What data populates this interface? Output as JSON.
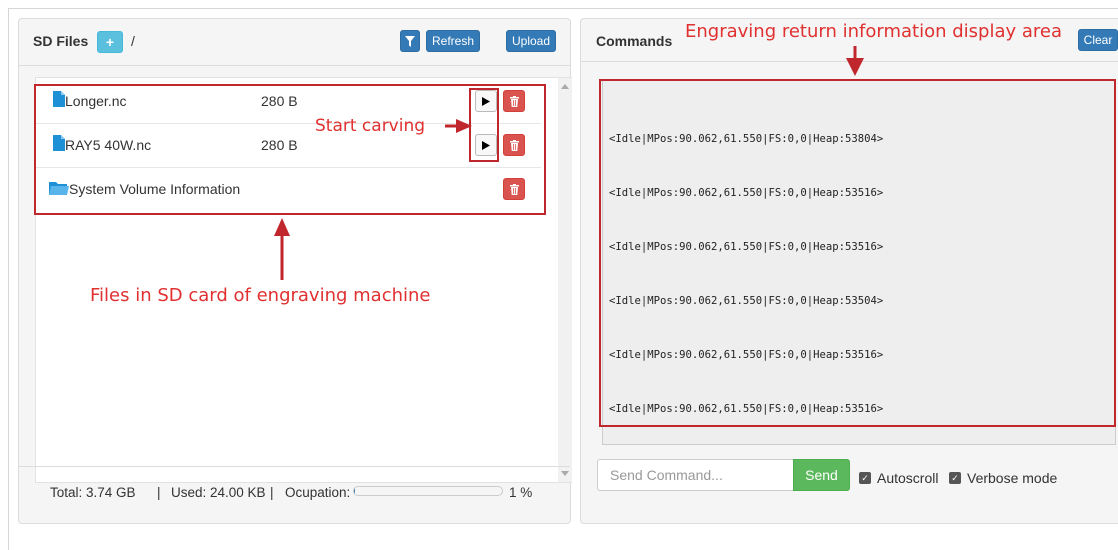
{
  "sd_panel": {
    "title": "SD Files",
    "path": "/",
    "add_folder_label": "+",
    "filter_icon": "filter-icon",
    "refresh_label": "Refresh",
    "upload_label": "Upload",
    "files": [
      {
        "name": "Longer.nc",
        "size": "280 B",
        "type": "file"
      },
      {
        "name": "RAY5 40W.nc",
        "size": "280 B",
        "type": "file"
      },
      {
        "name": "System Volume Information",
        "size": "",
        "type": "folder"
      }
    ],
    "footer": {
      "total": "Total: 3.74 GB",
      "sep1": "|",
      "used": "Used: 24.00 KB",
      "sep2": "|",
      "ocupation_label": "Ocupation:",
      "ocupation_percent": "1 %",
      "ocupation_fraction": 0.01
    }
  },
  "commands_panel": {
    "title": "Commands",
    "clear_label": "Clear",
    "lines": [
      "<Idle|MPos:90.062,61.550|FS:0,0|Heap:53804>",
      "<Idle|MPos:90.062,61.550|FS:0,0|Heap:53516>",
      "<Idle|MPos:90.062,61.550|FS:0,0|Heap:53516>",
      "<Idle|MPos:90.062,61.550|FS:0,0|Heap:53504>",
      "<Idle|MPos:90.062,61.550|FS:0,0|Heap:53516>",
      "<Idle|MPos:90.062,61.550|FS:0,0|Heap:53516>"
    ],
    "input_placeholder": "Send Command...",
    "send_label": "Send",
    "autoscroll_label": "Autoscroll",
    "verbose_label": "Verbose mode"
  },
  "annotations": {
    "display_area": "Engraving return information display area",
    "start_carving": "Start carving",
    "files_in_sd": "Files in SD card of engraving machine"
  },
  "colors": {
    "primary": "#337ab7",
    "info": "#5bc0de",
    "danger": "#d9534f",
    "success": "#5cb85c",
    "annotation": "#e03030"
  }
}
